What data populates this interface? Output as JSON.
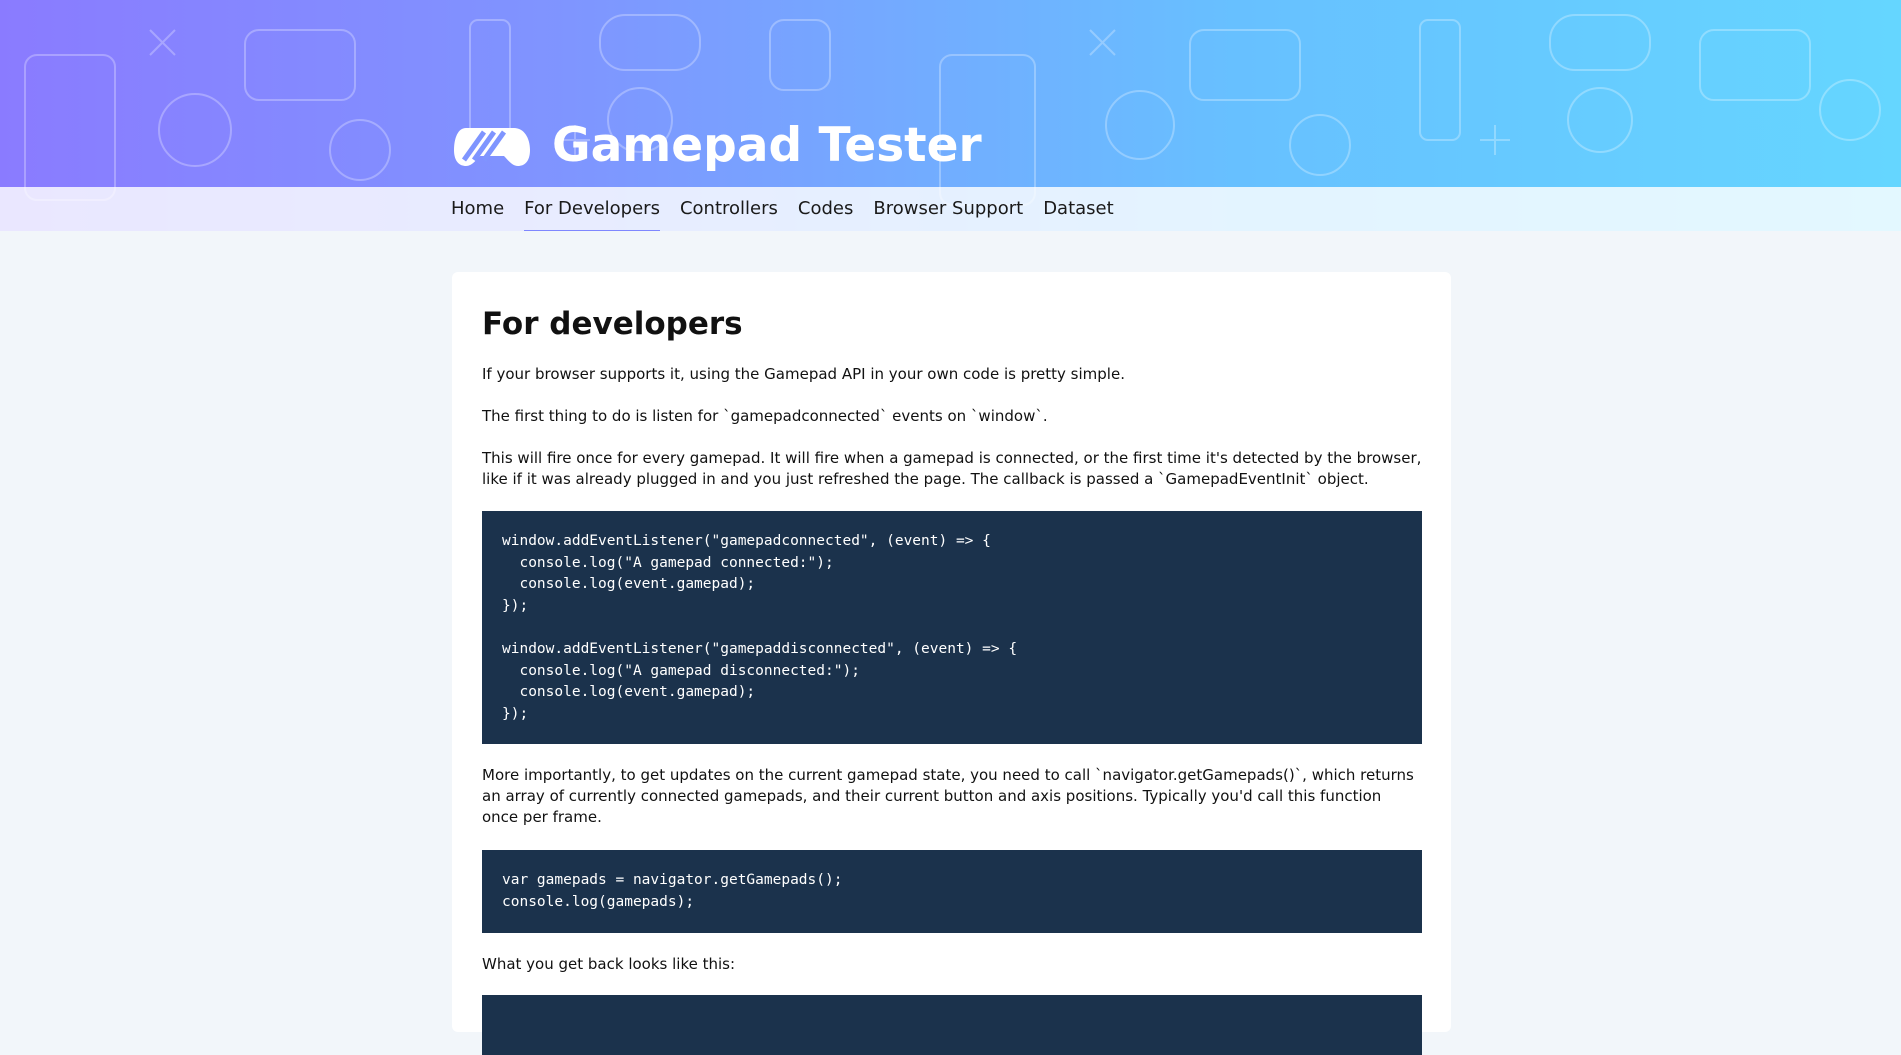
{
  "header": {
    "title": "Gamepad Tester",
    "logo_icon": "gamepad-logo-icon",
    "pattern_icons": "controller-pattern"
  },
  "nav": {
    "items": [
      {
        "label": "Home"
      },
      {
        "label": "For Developers",
        "active": true
      },
      {
        "label": "Controllers"
      },
      {
        "label": "Codes"
      },
      {
        "label": "Browser Support"
      },
      {
        "label": "Dataset"
      }
    ]
  },
  "main": {
    "heading": "For developers",
    "paragraph_1": "If your browser supports it, using the Gamepad API in your own code is pretty simple.",
    "paragraph_2": "The first thing to do is listen for `gamepadconnected` events on `window`.",
    "paragraph_3": "This will fire once for every gamepad. It will fire when a gamepad is connected, or the first time it's detected by the browser, like if it was already plugged in and you just refreshed the page. The callback is passed a `GamepadEventInit` object.",
    "code_1": "window.addEventListener(\"gamepadconnected\", (event) => {\n  console.log(\"A gamepad connected:\");\n  console.log(event.gamepad);\n});\n\nwindow.addEventListener(\"gamepaddisconnected\", (event) => {\n  console.log(\"A gamepad disconnected:\");\n  console.log(event.gamepad);\n});",
    "paragraph_4": "More importantly, to get updates on the current gamepad state, you need to call `navigator.getGamepads()`, which returns an array of currently connected gamepads, and their current button and axis positions. Typically you'd call this function once per frame.",
    "code_2": "var gamepads = navigator.getGamepads();\nconsole.log(gamepads);",
    "paragraph_5": "What you get back looks like this:",
    "code_3": ""
  },
  "colors": {
    "header_gradient_start": "#8a7bff",
    "header_gradient_end": "#65d6ff",
    "nav_active_underline": "#7f87ff",
    "code_background": "#1b324c",
    "page_background": "#f2f6fa"
  }
}
